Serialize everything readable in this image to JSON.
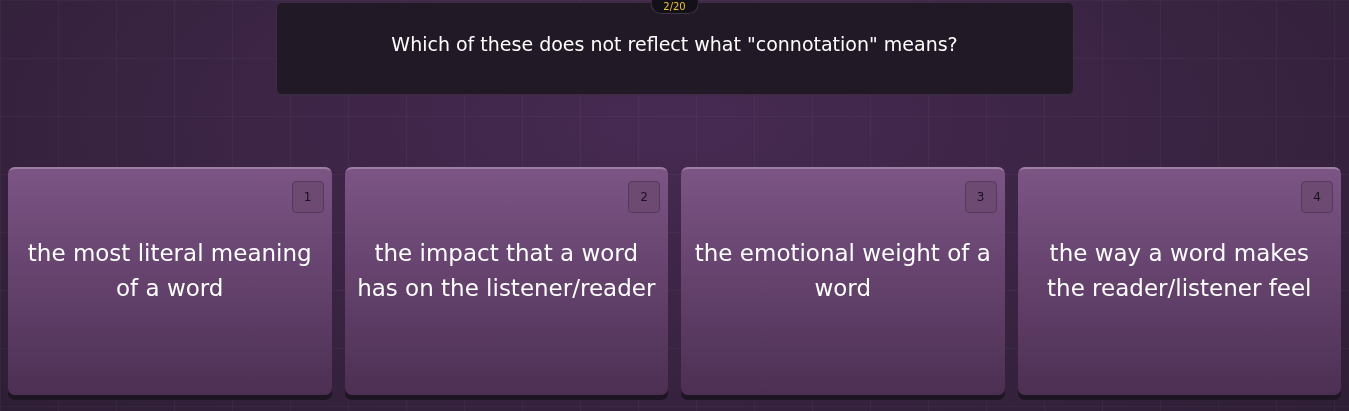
{
  "counter": "2/20",
  "question": "Which of these does not reflect what \"connotation\" means?",
  "options": [
    {
      "number": "1",
      "text": "the most literal meaning of a word"
    },
    {
      "number": "2",
      "text": "the impact that a word has on the listener/reader"
    },
    {
      "number": "3",
      "text": "the emotional weight of a word"
    },
    {
      "number": "4",
      "text": "the way a word makes the reader/listener feel"
    }
  ]
}
